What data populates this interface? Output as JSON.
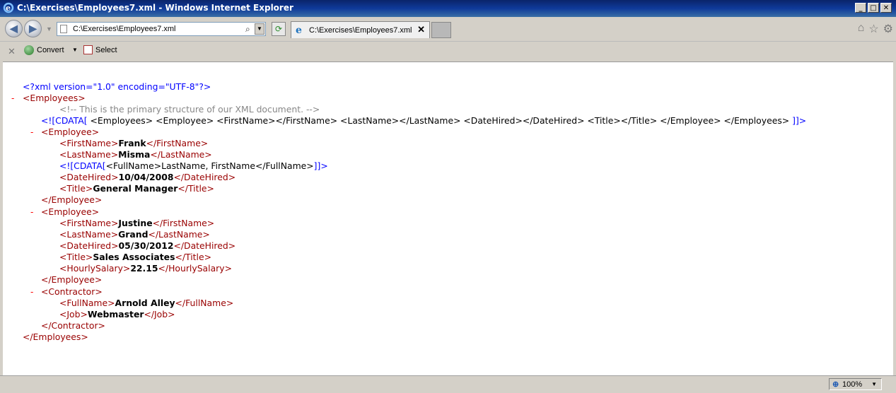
{
  "window": {
    "title": "C:\\Exercises\\Employees7.xml - Windows Internet Explorer",
    "min": "_",
    "max": "□",
    "close": "✕"
  },
  "nav": {
    "back": "◀",
    "forward": "▶",
    "url": "C:\\Exercises\\Employees7.xml",
    "search_icon": "search-icon",
    "refresh": "⟳"
  },
  "tab": {
    "label": "C:\\Exercises\\Employees7.xml",
    "close": "✕"
  },
  "toolbar_right": {
    "home": "⌂",
    "favorites": "☆",
    "tools": "⚙"
  },
  "cmdbar": {
    "stop": "✕",
    "convert": "Convert",
    "select": "Select"
  },
  "xml": {
    "decl": "<?xml version=\"1.0\" encoding=\"UTF-8\"?>",
    "minus": "-",
    "employees_open": "<Employees>",
    "comment": "<!-- This is the primary structure of our XML document. -->",
    "cdata_open": "<![CDATA[",
    "cdata1_text": "<Employees> <Employee> <FirstName></FirstName> <LastName></LastName> <DateHired></DateHired> <Title></Title> </Employee> </Employees>",
    "cdata_close": "]]>",
    "emp1": {
      "open": "<Employee>",
      "fn_open": "<FirstName>",
      "fn": "Frank",
      "fn_close": "</FirstName>",
      "ln_open": "<LastName>",
      "ln": "Misma",
      "ln_close": "</LastName>",
      "cdata_text": "<FullName>LastName, FirstName</FullName>",
      "dh_open": "<DateHired>",
      "dh": "10/04/2008",
      "dh_close": "</DateHired>",
      "ti_open": "<Title>",
      "ti": "General Manager",
      "ti_close": "</Title>",
      "close": "</Employee>"
    },
    "emp2": {
      "open": "<Employee>",
      "fn_open": "<FirstName>",
      "fn": "Justine",
      "fn_close": "</FirstName>",
      "ln_open": "<LastName>",
      "ln": "Grand",
      "ln_close": "</LastName>",
      "dh_open": "<DateHired>",
      "dh": "05/30/2012",
      "dh_close": "</DateHired>",
      "ti_open": "<Title>",
      "ti": "Sales Associates",
      "ti_close": "</Title>",
      "hs_open": "<HourlySalary>",
      "hs": "22.15",
      "hs_close": "</HourlySalary>",
      "close": "</Employee>"
    },
    "con": {
      "open": "<Contractor>",
      "fu_open": "<FullName>",
      "fu": "Arnold Alley",
      "fu_close": "</FullName>",
      "jb_open": "<Job>",
      "jb": "Webmaster",
      "jb_close": "</Job>",
      "close": "</Contractor>"
    },
    "employees_close": "</Employees>"
  },
  "status": {
    "zoom": "100%"
  }
}
